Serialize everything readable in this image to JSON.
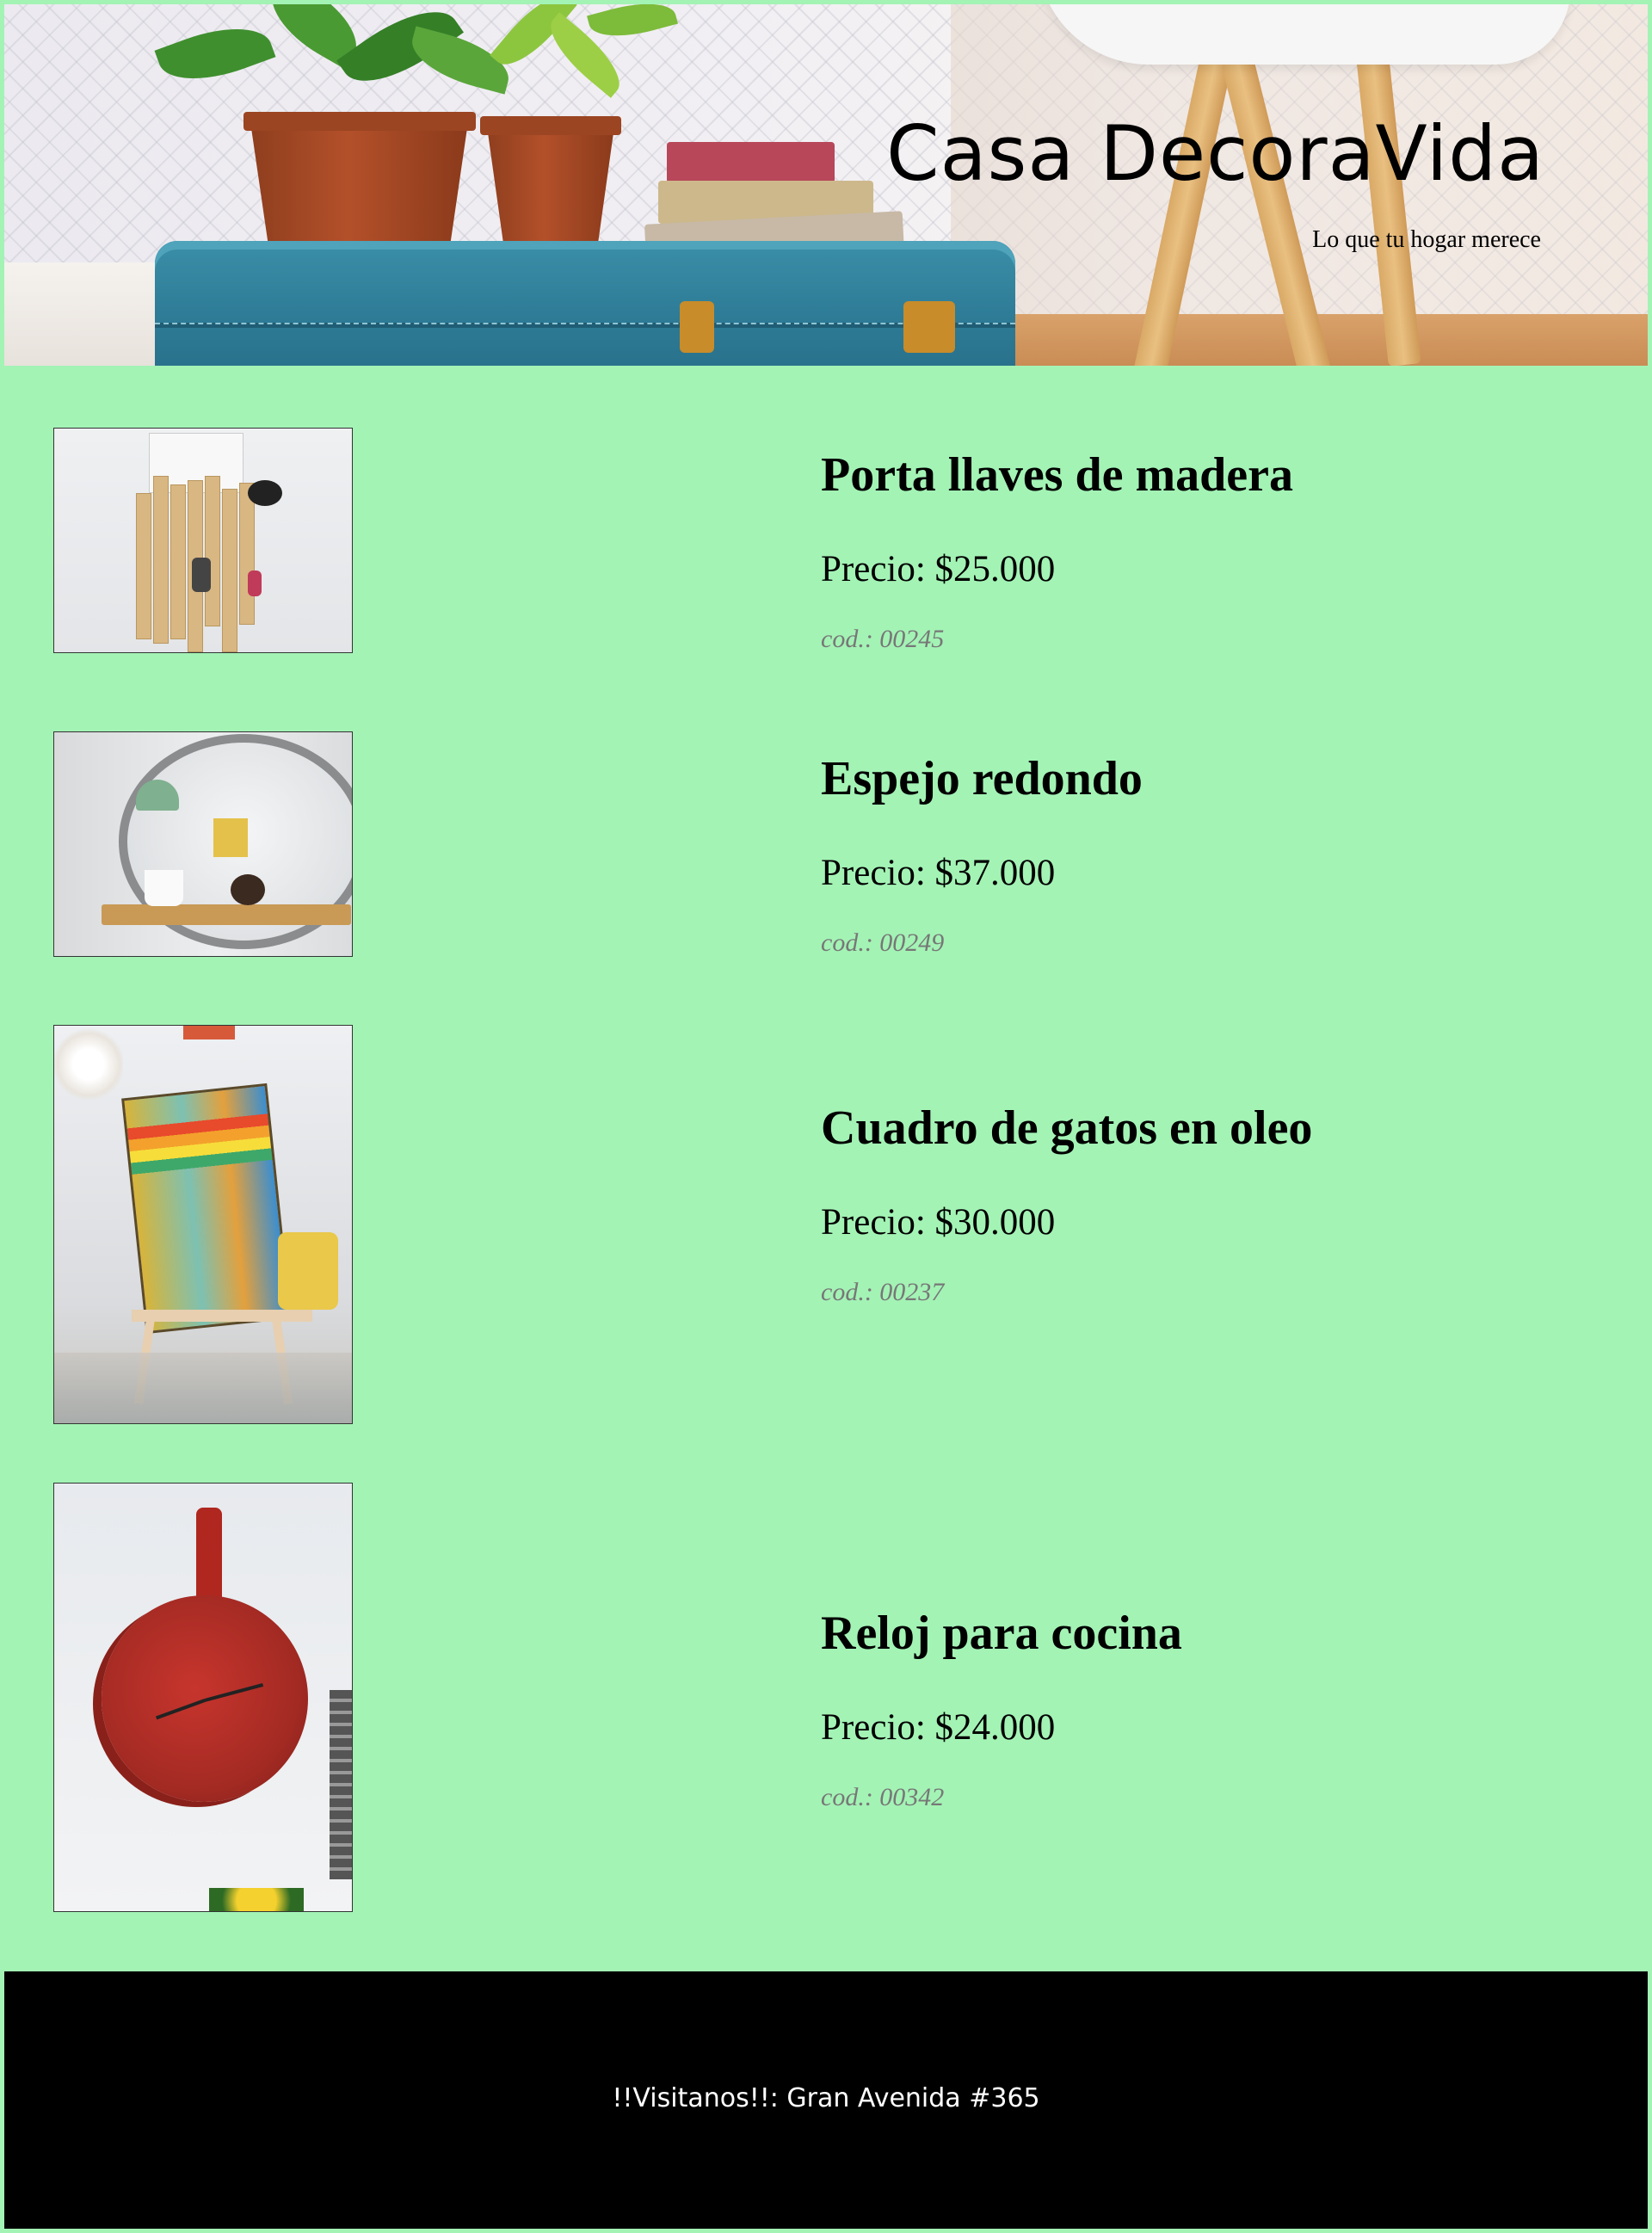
{
  "header": {
    "brand": "Casa DecoraVida",
    "tagline": "Lo que tu hogar merece"
  },
  "products": [
    {
      "name": "Porta llaves de madera",
      "price": "Precio: $25.000",
      "code": "cod.: 00245",
      "image": "key-holder-image"
    },
    {
      "name": "Espejo redondo",
      "price": "Precio: $37.000",
      "code": "cod.: 00249",
      "image": "round-mirror-image"
    },
    {
      "name": "Cuadro de gatos en oleo",
      "price": "Precio: $30.000",
      "code": "cod.: 00237",
      "image": "cat-painting-image"
    },
    {
      "name": "Reloj para cocina",
      "price": "Precio: $24.000",
      "code": "cod.: 00342",
      "image": "kitchen-clock-image"
    }
  ],
  "footer": {
    "text": "!!Visitanos!!: Gran Avenida #365"
  },
  "colors": {
    "page_background": "#a3f3b5",
    "footer_background": "#000000",
    "code_text": "#777777"
  }
}
